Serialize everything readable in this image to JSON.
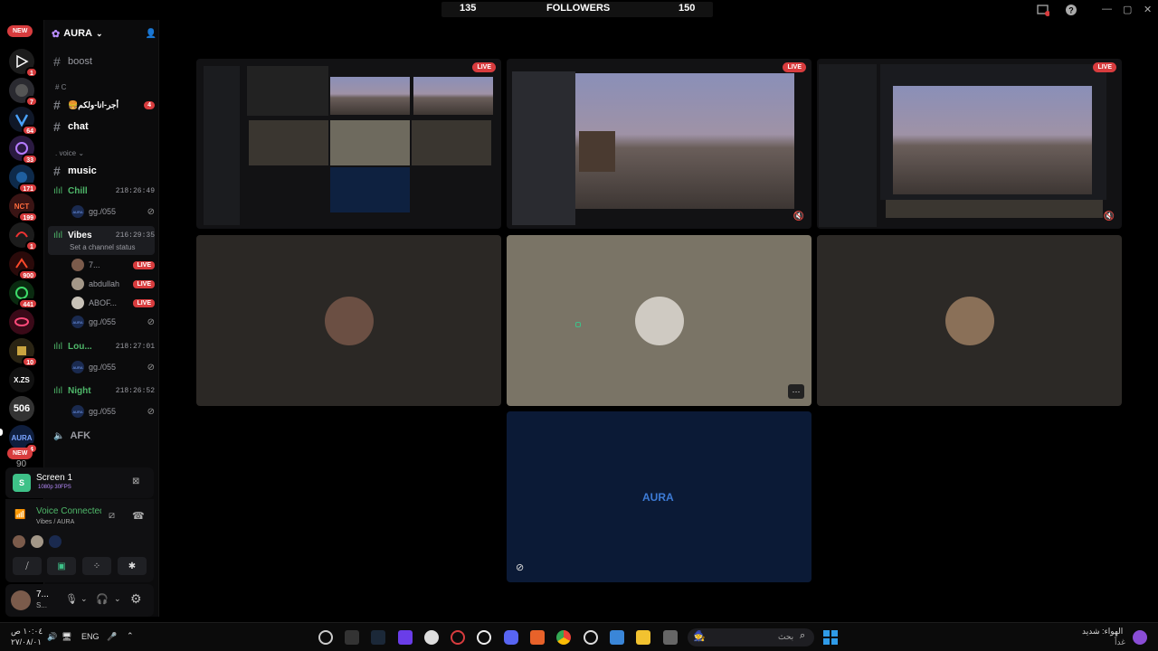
{
  "topbar": {
    "left_count": "135",
    "label": "FOLLOWERS",
    "right_count": "150"
  },
  "rail": {
    "new_top": "NEW",
    "new_bottom": "NEW",
    "badges": [
      "1",
      "7",
      "64",
      "33",
      "171",
      "199",
      "1",
      "900",
      "441",
      "10",
      "4"
    ],
    "text_icons": [
      "X.ZS",
      "506",
      "AURA"
    ],
    "bottom_label": "90"
  },
  "guild": {
    "name": "AURA"
  },
  "channels": {
    "boost": "boost",
    "cat_c": "C",
    "arabic_channel": "🍔أجر-انا-ولكم",
    "arabic_badge": "4",
    "chat": "chat",
    "cat_voice": "voice",
    "music": "music",
    "afk": "AFK"
  },
  "voice_channels": [
    {
      "name": "Chill",
      "time": "218:26:49",
      "members": [
        {
          "name": "gg./055",
          "av": "AURA"
        }
      ]
    },
    {
      "name": "Vibes",
      "time": "216:29:35",
      "status": "Set a channel status",
      "members": [
        {
          "name": "7...",
          "live": "LIVE"
        },
        {
          "name": "abdullah",
          "live": "LIVE"
        },
        {
          "name": "ABOF...",
          "live": "LIVE"
        },
        {
          "name": "gg./055",
          "av": "AURA"
        }
      ]
    },
    {
      "name": "Lou...",
      "time": "218:27:01",
      "members": [
        {
          "name": "gg./055",
          "av": "AURA"
        }
      ]
    },
    {
      "name": "Night",
      "time": "218:26:52",
      "members": [
        {
          "name": "gg./055",
          "av": "AURA"
        }
      ]
    }
  ],
  "screen_share": {
    "title": "Screen 1",
    "quality": "1080p 30FPS"
  },
  "voice": {
    "status": "Voice Connected",
    "location": "Vibes / AURA"
  },
  "user": {
    "name": "7...",
    "sub": "S..."
  },
  "tiles": {
    "live": "LIVE",
    "aura": "AURA",
    "more": "···"
  },
  "taskbar": {
    "time": "١٠:٠٤ ص",
    "date": "٢٧/٠٨/٠١",
    "lang": "ENG",
    "search_placeholder": "بحث",
    "weather_line1": "الهواء: شديد",
    "weather_line2": "غداً"
  },
  "colors": {
    "accent_green": "#4fb86a",
    "live_red": "#d83c3e",
    "aura_blue": "#3d7bd6"
  }
}
